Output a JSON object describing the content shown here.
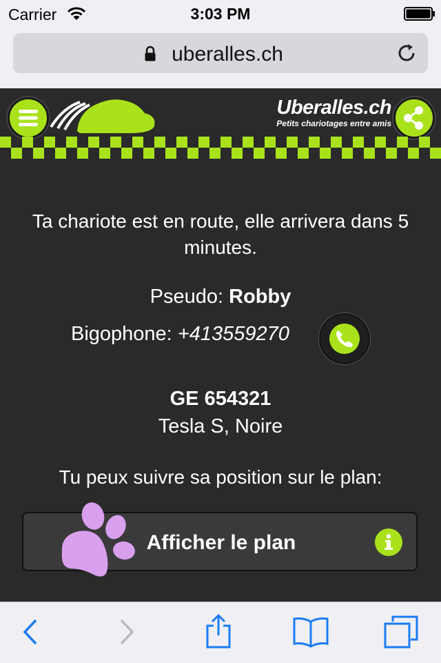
{
  "status_bar": {
    "carrier": "Carrier",
    "time": "3:03 PM"
  },
  "url_bar": {
    "url": "uberalles.ch"
  },
  "header": {
    "brand": "Uberalles.ch",
    "tagline": "Petits chariotages entre amis",
    "accent_color": "#a9e21b"
  },
  "content": {
    "message": "Ta chariote est en route, elle arrivera dans 5 minutes.",
    "pseudo_label": "Pseudo: ",
    "pseudo_value": "Robby",
    "phone_label": "Bigophone: ",
    "phone_value": "+413559270",
    "plate": "GE 654321",
    "car_model": "Tesla S, Noire",
    "follow_text": "Tu peux suivre sa position sur le plan:",
    "map_button_label": "Afficher le plan"
  },
  "icons": [
    "wifi-icon",
    "battery-icon",
    "lock-icon",
    "reload-icon",
    "menu-icon",
    "share-icon",
    "phone-icon",
    "info-icon",
    "paw-icon",
    "back-icon",
    "forward-icon",
    "share-page-icon",
    "bookmarks-icon",
    "tabs-icon"
  ]
}
